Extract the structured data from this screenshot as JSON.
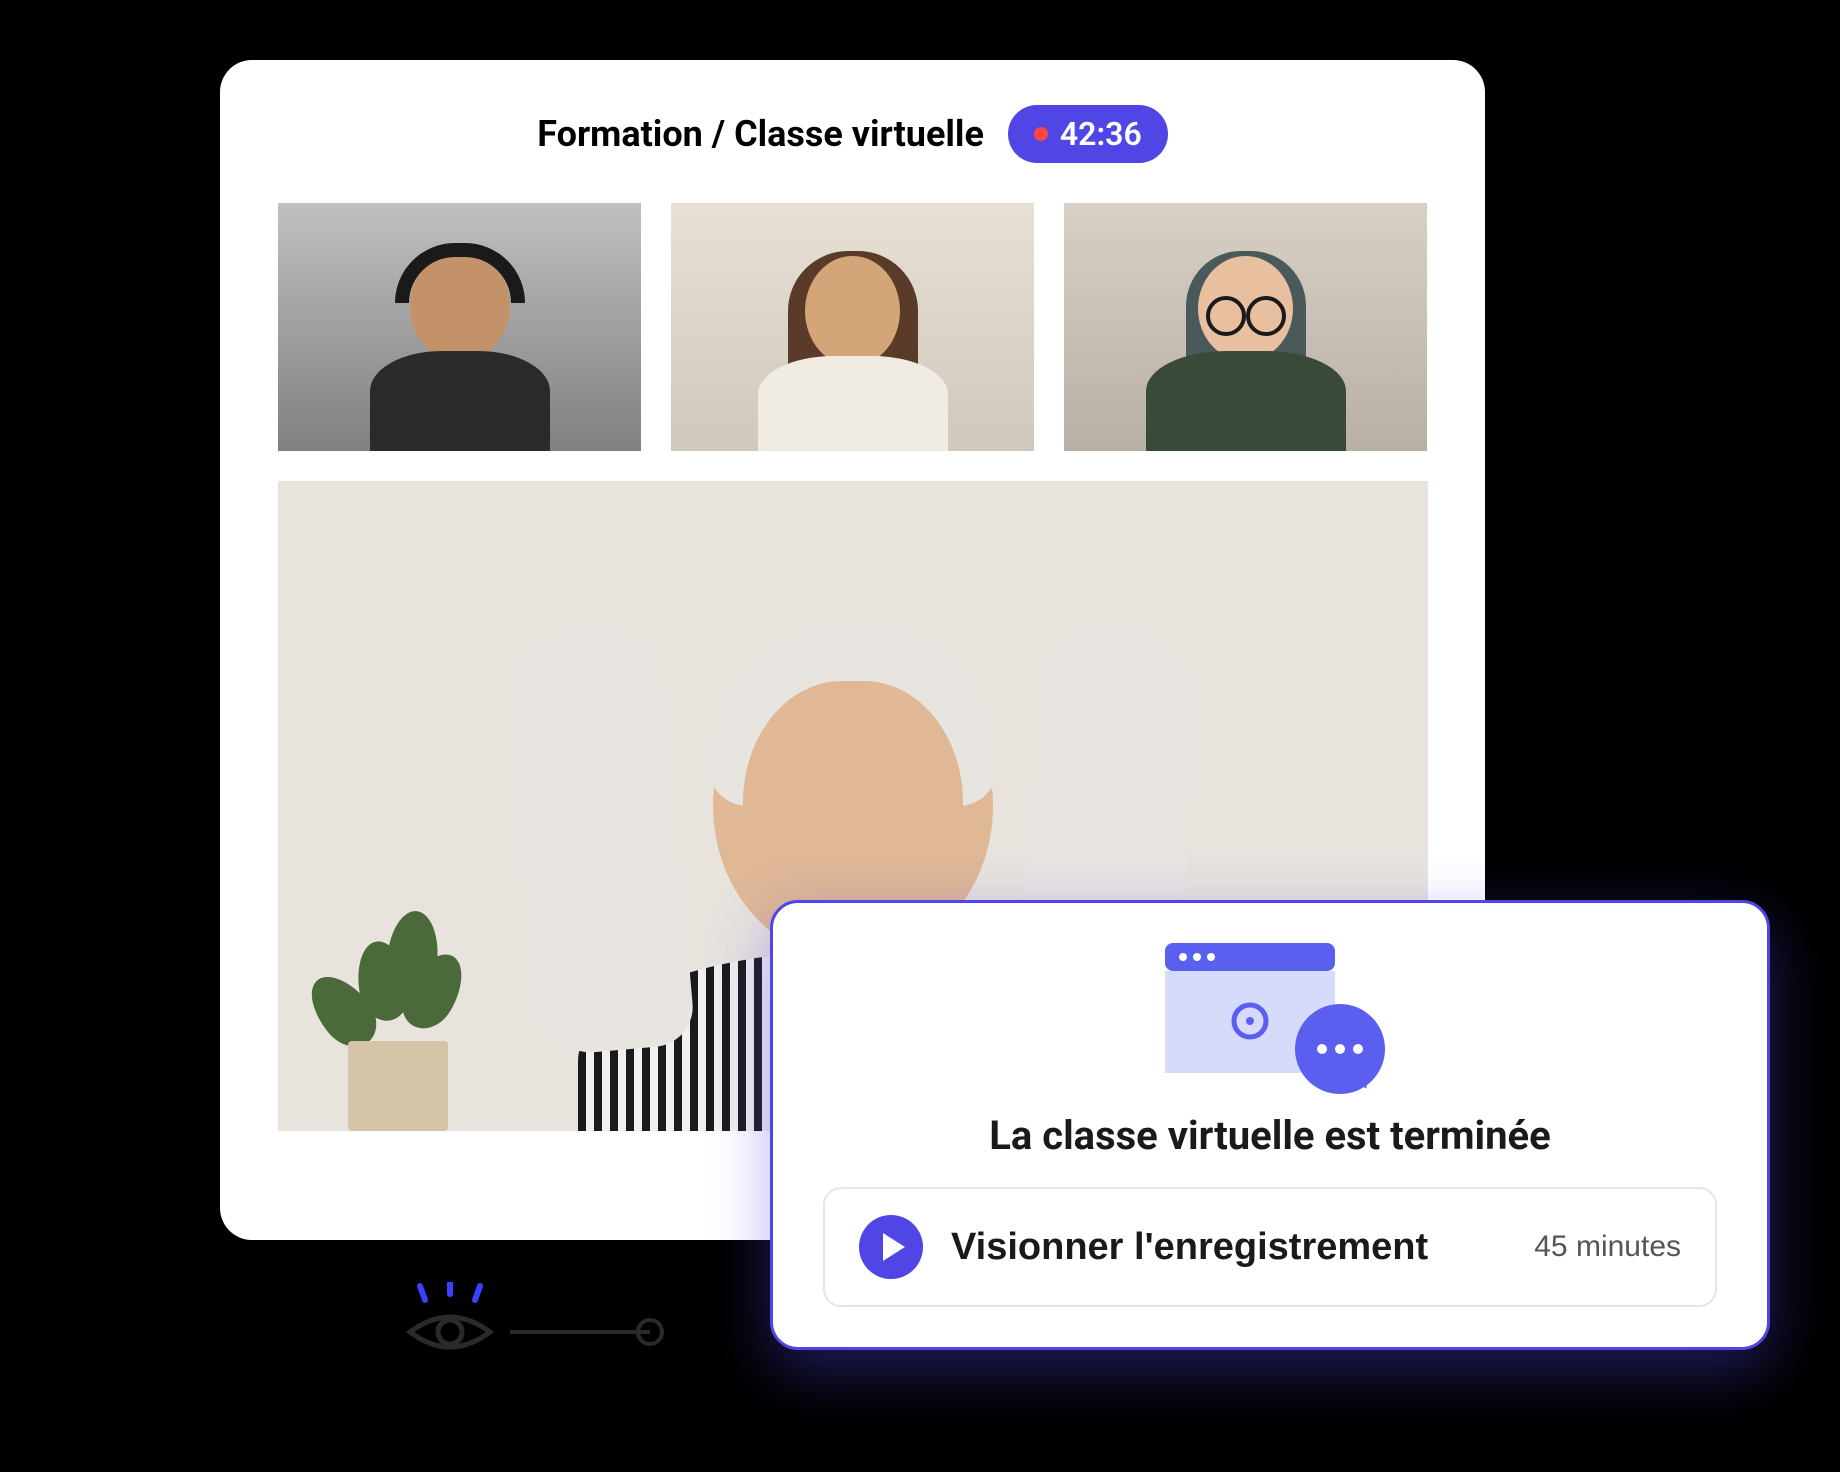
{
  "header": {
    "breadcrumb": "Formation / Classe virtuelle",
    "timer": "42:36"
  },
  "participants": {
    "small": [
      {
        "name": "participant-1"
      },
      {
        "name": "participant-2"
      },
      {
        "name": "participant-3"
      }
    ],
    "main": {
      "name": "participant-main"
    }
  },
  "completion": {
    "title": "La classe virtuelle est terminée",
    "watch_label": "Visionner l'enregistrement",
    "duration": "45 minutes"
  },
  "colors": {
    "accent": "#4F46E5",
    "record_dot": "#FF4444"
  }
}
